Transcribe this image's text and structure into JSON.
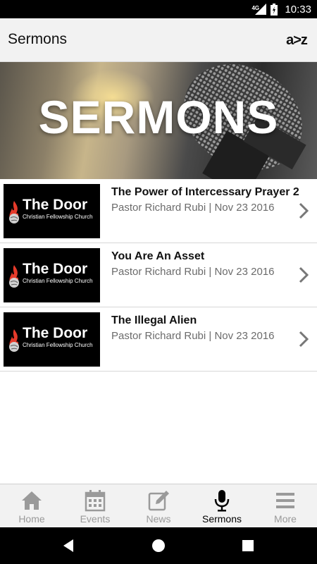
{
  "status_bar": {
    "network": "4G",
    "time": "10:33"
  },
  "app_bar": {
    "title": "Sermons",
    "sort_label": "a>z",
    "sort_icon": "az-sort-icon"
  },
  "hero": {
    "title": "SERMONS"
  },
  "thumbnail": {
    "name": "The Door",
    "subtitle": "Christian Fellowship Church"
  },
  "sermons": [
    {
      "title": "The Power of Intercessary Prayer 2",
      "speaker": "Pastor Richard Rubi",
      "date": "Nov 23 2016",
      "meta": "Pastor Richard Rubi | Nov 23 2016"
    },
    {
      "title": "You Are An Asset",
      "speaker": "Pastor Richard Rubi",
      "date": "Nov 23 2016",
      "meta": "Pastor Richard Rubi | Nov 23 2016"
    },
    {
      "title": "The Illegal Alien",
      "speaker": "Pastor Richard Rubi",
      "date": "Nov 23 2016",
      "meta": "Pastor Richard Rubi | Nov 23 2016"
    }
  ],
  "tabs": [
    {
      "label": "Home",
      "icon": "home-icon",
      "active": false
    },
    {
      "label": "Events",
      "icon": "calendar-icon",
      "active": false
    },
    {
      "label": "News",
      "icon": "edit-icon",
      "active": false
    },
    {
      "label": "Sermons",
      "icon": "microphone-icon",
      "active": true
    },
    {
      "label": "More",
      "icon": "menu-icon",
      "active": false
    }
  ],
  "colors": {
    "inactive_tab": "#9a9a9a",
    "active_tab": "#000000",
    "meta_text": "#6b6b6b",
    "bar_background": "#f2f2f2"
  }
}
